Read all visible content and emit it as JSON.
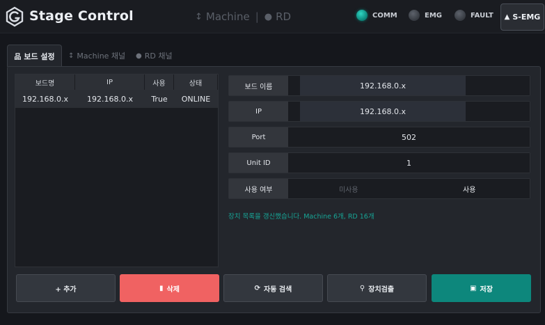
{
  "header": {
    "title": "Stage Control",
    "modes": [
      {
        "label": "Machine",
        "icon": "vertical-arrows-icon"
      },
      {
        "label": "RD",
        "icon": "bulb-icon"
      }
    ],
    "status": [
      {
        "label": "COMM",
        "state": "on"
      },
      {
        "label": "EMG",
        "state": "off"
      },
      {
        "label": "FAULT",
        "state": "off"
      }
    ],
    "semg_label": "S-EMG"
  },
  "tabs": [
    {
      "label": "보드 설정",
      "icon": "network-icon",
      "active": true
    },
    {
      "label": "Machine 채널",
      "icon": "vertical-arrows-icon",
      "active": false
    },
    {
      "label": "RD 채널",
      "icon": "bulb-icon",
      "active": false
    }
  ],
  "board_table": {
    "columns": [
      "보드명",
      "IP",
      "사용",
      "상태"
    ],
    "rows": [
      [
        "192.168.0.x",
        "192.168.0.x",
        "True",
        "ONLINE"
      ]
    ]
  },
  "form": {
    "board_name": {
      "label": "보드 이름",
      "value": "192.168.0.x"
    },
    "ip": {
      "label": "IP",
      "value": "192.168.0.x"
    },
    "port": {
      "label": "Port",
      "value": "502"
    },
    "unit_id": {
      "label": "Unit ID",
      "value": "1"
    },
    "use": {
      "label": "사용 여부",
      "off_label": "미사용",
      "on_label": "사용",
      "selected": "사용"
    }
  },
  "message": "장치 목록을 갱신했습니다. Machine 6개, RD 16개",
  "buttons": {
    "add": "+ 추가",
    "delete": "삭제",
    "auto_search": "자동 검색",
    "device_check": "장치검출",
    "save": "저장"
  },
  "colors": {
    "accent_teal": "#0d877c",
    "danger_red": "#f06262",
    "message_teal": "#17a596"
  }
}
